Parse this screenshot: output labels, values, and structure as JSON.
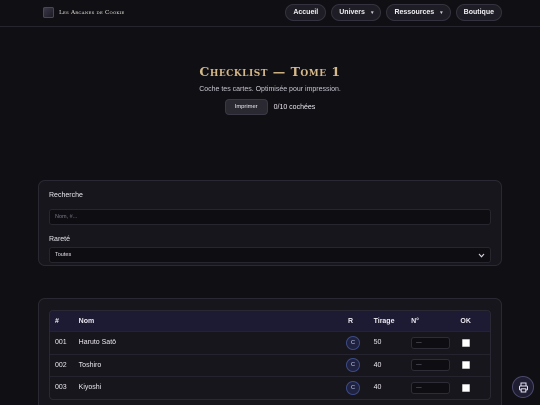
{
  "brand": {
    "name": "Les Arcanes de Cookie",
    "logo_icon": "brand-logo-icon"
  },
  "nav": {
    "items": [
      {
        "label": "Accueil",
        "dropdown": false
      },
      {
        "label": "Univers",
        "dropdown": true
      },
      {
        "label": "Ressources",
        "dropdown": true
      },
      {
        "label": "Boutique",
        "dropdown": false
      }
    ],
    "caret": "▾"
  },
  "hero": {
    "title": "Checklist — Tome 1",
    "subtitle": "Coche tes cartes. Optimisée pour impression.",
    "print_label": "Imprimer",
    "checked_count": "0/10 cochées"
  },
  "filters": {
    "search_label": "Recherche",
    "search_placeholder": "Nom, #...",
    "search_value": "",
    "rarity_label": "Rareté",
    "rarity_selected": "Toutes"
  },
  "table": {
    "columns": [
      "#",
      "Nom",
      "R",
      "Tirage",
      "N°",
      "OK"
    ],
    "rows": [
      {
        "num": "001",
        "name": "Haruto Satō",
        "rarity": "C",
        "tirage": "50",
        "no_placeholder": "—",
        "ok": false
      },
      {
        "num": "002",
        "name": "Toshiro",
        "rarity": "C",
        "tirage": "40",
        "no_placeholder": "—",
        "ok": false
      },
      {
        "num": "003",
        "name": "Kiyoshi",
        "rarity": "C",
        "tirage": "40",
        "no_placeholder": "—",
        "ok": false
      }
    ]
  },
  "colors": {
    "background": "#100f14",
    "title_gold": "#d6b98a",
    "table_header": "#1d1b33",
    "rarity_badge_border": "#3d4a86"
  },
  "fab": {
    "icon": "print-icon"
  }
}
